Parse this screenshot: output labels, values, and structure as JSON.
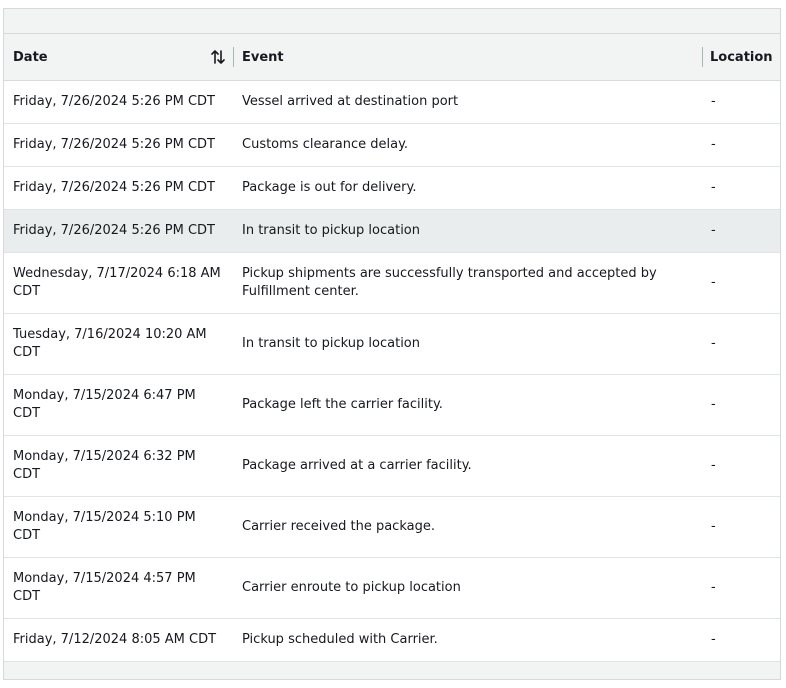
{
  "table": {
    "columns": {
      "date": "Date",
      "event": "Event",
      "location": "Location"
    },
    "rows": [
      {
        "date": "Friday, 7/26/2024 5:26 PM CDT",
        "event": "Vessel arrived at destination port",
        "location": "-"
      },
      {
        "date": "Friday, 7/26/2024 5:26 PM CDT",
        "event": "Customs clearance delay.",
        "location": "-"
      },
      {
        "date": "Friday, 7/26/2024 5:26 PM CDT",
        "event": "Package is out for delivery.",
        "location": "-"
      },
      {
        "date": "Friday, 7/26/2024 5:26 PM CDT",
        "event": "In transit to pickup location",
        "location": "-"
      },
      {
        "date": "Wednesday, 7/17/2024 6:18 AM CDT",
        "event": "Pickup shipments are successfully transported and accepted by Fulfillment center.",
        "location": "-"
      },
      {
        "date": "Tuesday, 7/16/2024 10:20 AM CDT",
        "event": "In transit to pickup location",
        "location": "-"
      },
      {
        "date": "Monday, 7/15/2024 6:47 PM CDT",
        "event": "Package left the carrier facility.",
        "location": "-"
      },
      {
        "date": "Monday, 7/15/2024 6:32 PM CDT",
        "event": "Package arrived at a carrier facility.",
        "location": "-"
      },
      {
        "date": "Monday, 7/15/2024 5:10 PM CDT",
        "event": "Carrier received the package.",
        "location": "-"
      },
      {
        "date": "Monday, 7/15/2024 4:57 PM CDT",
        "event": "Carrier enroute to pickup location",
        "location": "-"
      },
      {
        "date": "Friday, 7/12/2024 8:05 AM CDT",
        "event": "Pickup scheduled with Carrier.",
        "location": "-"
      }
    ],
    "highlighted_row": 3,
    "sort_icon": "sort-arrows-icon"
  }
}
